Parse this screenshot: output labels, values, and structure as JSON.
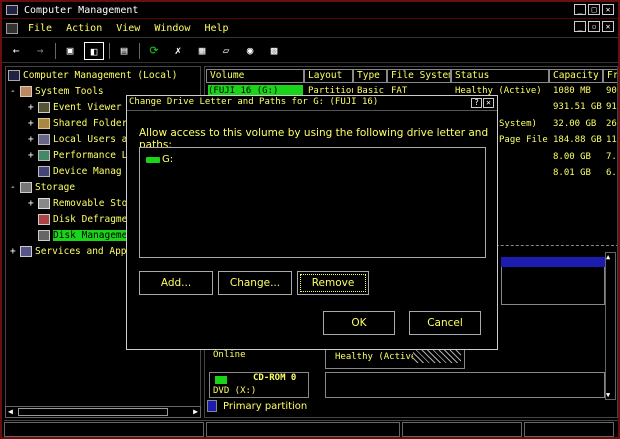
{
  "window": {
    "title": "Computer Management"
  },
  "menubar": {
    "items": [
      "File",
      "Action",
      "View",
      "Window",
      "Help"
    ]
  },
  "tree": {
    "root": "Computer Management (Local)",
    "system_tools": "System Tools",
    "event_viewer": "Event Viewer",
    "shared_folders": "Shared Folder",
    "local_users": "Local Users a",
    "performance": "Performance L",
    "device_manager": "Device Manag",
    "storage": "Storage",
    "removable": "Removable Sto",
    "defrag": "Disk Defragme",
    "disk_mgmt": "Disk Manageme",
    "services": "Services and Appl"
  },
  "columns": [
    "Volume",
    "Layout",
    "Type",
    "File System",
    "Status",
    "Capacity",
    "Fr"
  ],
  "rows": [
    {
      "volume": "(FUJI 16 (G:)",
      "layout": "Partition",
      "type": "Basic",
      "fs": "FAT",
      "status": "Healthy (Active)",
      "capacity": "1080 MB",
      "free": "90"
    },
    {
      "volume": "",
      "layout": "",
      "type": "",
      "fs": "",
      "status": "",
      "capacity": "931.51 GB",
      "free": "91"
    },
    {
      "volume": "",
      "layout": "",
      "type": "",
      "fs": "",
      "status": "System)",
      "capacity": "32.00 GB",
      "free": "26"
    },
    {
      "volume": "",
      "layout": "",
      "type": "",
      "fs": "",
      "status": "Page File)",
      "capacity": "184.88 GB",
      "free": "11"
    },
    {
      "volume": "",
      "layout": "",
      "type": "",
      "fs": "",
      "status": "",
      "capacity": "8.00 GB",
      "free": "7."
    },
    {
      "volume": "",
      "layout": "",
      "type": "",
      "fs": "",
      "status": "",
      "capacity": "8.01 GB",
      "free": "6."
    }
  ],
  "lower": {
    "online": "Online",
    "healthy": "Healthy (Active)",
    "cdrom": "CD-ROM 0",
    "dvd": "DVD (X:)"
  },
  "legend": {
    "primary": "Primary partition"
  },
  "dialog": {
    "title": "Change Drive Letter and Paths for G: (FUJI 16)",
    "lead": "Allow access to this volume by using the following drive letter and paths:",
    "entry": "G:",
    "add": "Add...",
    "change": "Change...",
    "remove": "Remove",
    "ok": "OK",
    "cancel": "Cancel"
  },
  "colors": {
    "accent": "#19d419",
    "text": "#ffff66",
    "border": "#6a0f0f",
    "partition_blue": "#1c1cb0"
  }
}
